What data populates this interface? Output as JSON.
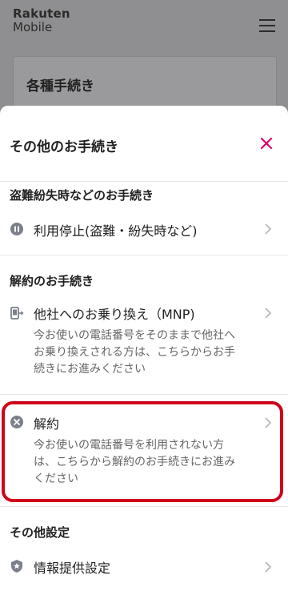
{
  "header": {
    "logo_line1": "Rakuten",
    "logo_line2": "Mobile",
    "menu_icon": "hamburger-menu-icon"
  },
  "background_card": {
    "title": "各種手続き"
  },
  "sheet": {
    "title": "その他のお手続き",
    "close_icon": "close-icon",
    "sections": [
      {
        "title": "盗難紛失時などのお手続き",
        "items": [
          {
            "icon": "pause-icon",
            "label": "利用停止(盗難・紛失時など)"
          }
        ]
      },
      {
        "title": "解約のお手続き",
        "items": [
          {
            "icon": "phone-transfer-icon",
            "label": "他社へのお乗り換え（MNP)",
            "desc_lines": [
              "今お使いの電話番号をそのままで他社へ",
              "お乗り換えされる方は、こちらからお手",
              "続きにお進みください"
            ]
          },
          {
            "icon": "cancel-circle-icon",
            "label": "解約",
            "desc_lines": [
              "今お使いの電話番号を利用されない方",
              "は、こちらから解約のお手続きにお進み",
              "ください"
            ]
          }
        ]
      },
      {
        "title": "その他設定",
        "items": [
          {
            "icon": "shield-star-icon",
            "label": "情報提供設定"
          }
        ]
      }
    ]
  },
  "colors": {
    "accent_close": "#e0006a",
    "highlight_border": "#d0021b",
    "overlay": "#8f8f91"
  }
}
